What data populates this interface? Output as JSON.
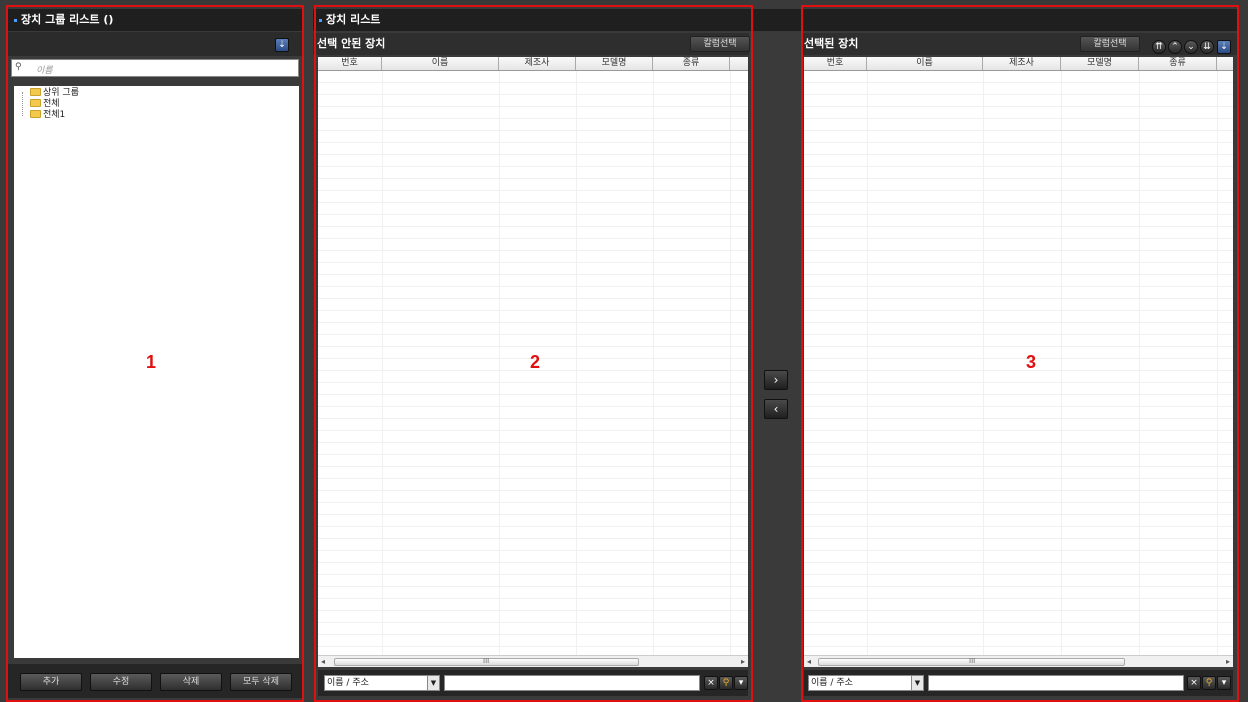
{
  "left": {
    "title": "장치 그룹 리스트 ()",
    "search_placeholder": "이름",
    "tree": [
      {
        "label": "상위 그룹"
      },
      {
        "label": "전체"
      },
      {
        "label": "전체1"
      }
    ],
    "buttons": {
      "add": "추가",
      "edit": "수정",
      "delete": "삭제",
      "delete_all": "모두 삭제"
    },
    "marker": "1"
  },
  "center": {
    "title": "장치 리스트",
    "unselected": {
      "heading": "선택 안된 장치",
      "column_select": "칼럼선택",
      "columns": [
        "번호",
        "이름",
        "제조사",
        "모델명",
        "종류"
      ],
      "search_type": "이름 / 주소",
      "scroll_grip": "III",
      "marker": "2"
    },
    "move_right": "›",
    "move_left": "‹"
  },
  "right": {
    "heading": "선택된 장치",
    "column_select": "칼럼선택",
    "columns": [
      "번호",
      "이름",
      "제조사",
      "모델명",
      "종류"
    ],
    "search_type": "이름 / 주소",
    "scroll_grip": "III",
    "marker": "3"
  }
}
